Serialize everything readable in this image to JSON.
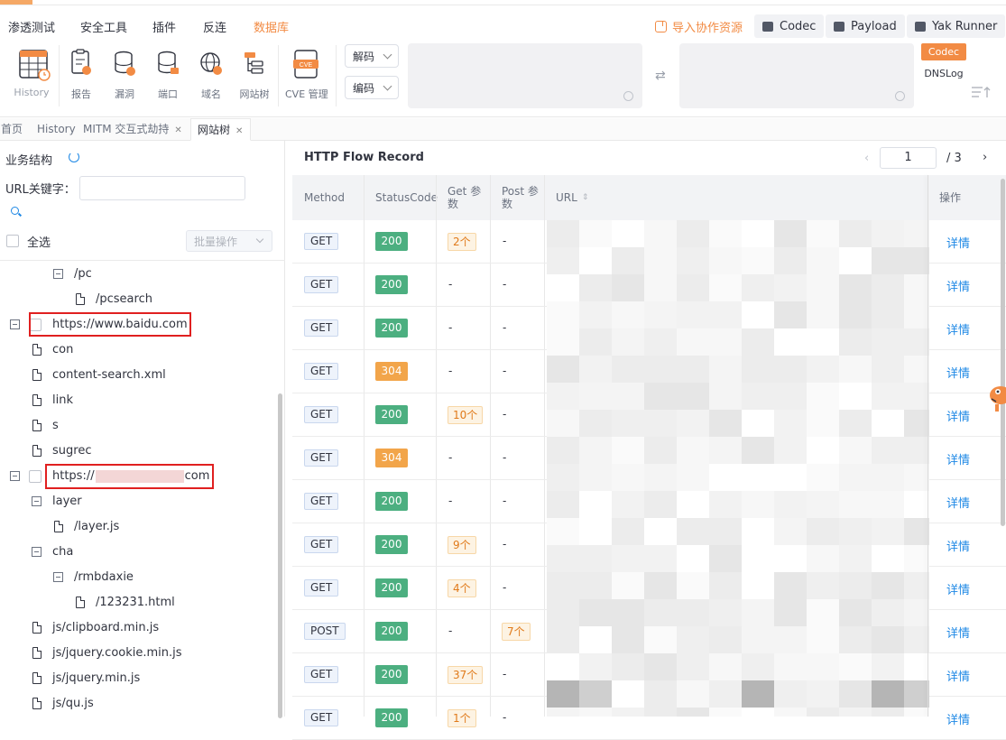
{
  "menu": {
    "items": [
      "渗透测试",
      "安全工具",
      "插件",
      "反连",
      "数据库"
    ],
    "active": "数据库",
    "import_label": "导入协作资源",
    "buttons": [
      "Codec",
      "Payload",
      "Yak Runner"
    ]
  },
  "toolbar": {
    "tools": [
      "History",
      "报告",
      "漏洞",
      "端口",
      "域名",
      "网站树",
      "CVE 管理"
    ],
    "decode_label": "解码",
    "encode_label": "编码",
    "codec_tag": "Codec",
    "dnslog_tag": "DNSLog",
    "cve_badge": "CVE"
  },
  "tabs": [
    {
      "label": "首页",
      "closable": false
    },
    {
      "label": "History",
      "closable": false
    },
    {
      "label": "MITM 交互式劫持",
      "closable": true
    },
    {
      "label": "网站树",
      "closable": true
    }
  ],
  "left_panel": {
    "title": "业务结构",
    "url_label": "URL关键字：",
    "select_all": "全选",
    "batch_label": "批量操作",
    "tree": [
      {
        "label": "/pc",
        "type": "folder",
        "depth": 2
      },
      {
        "label": "/pcsearch",
        "type": "file",
        "depth": 3
      },
      {
        "label": "https://www.baidu.com",
        "type": "root"
      },
      {
        "label": "con",
        "type": "file",
        "depth": 1
      },
      {
        "label": "content-search.xml",
        "type": "file",
        "depth": 1
      },
      {
        "label": "link",
        "type": "file",
        "depth": 1
      },
      {
        "label": "s",
        "type": "file",
        "depth": 1
      },
      {
        "label": "sugrec",
        "type": "file",
        "depth": 1
      },
      {
        "label_prefix": "https://",
        "label_suffix": "com",
        "type": "root-redacted"
      },
      {
        "label": "layer",
        "type": "folder",
        "depth": 1
      },
      {
        "label": "/layer.js",
        "type": "file",
        "depth": 2
      },
      {
        "label": "cha",
        "type": "folder",
        "depth": 1
      },
      {
        "label": "/rmbdaxie",
        "type": "folder",
        "depth": 2
      },
      {
        "label": "/123231.html",
        "type": "file",
        "depth": 3
      },
      {
        "label": "js/clipboard.min.js",
        "type": "file",
        "depth": 1
      },
      {
        "label": "js/jquery.cookie.min.js",
        "type": "file",
        "depth": 1
      },
      {
        "label": "js/jquery.min.js",
        "type": "file",
        "depth": 1
      },
      {
        "label": "js/qu.js",
        "type": "file",
        "depth": 1
      }
    ]
  },
  "records": {
    "title": "HTTP Flow Record",
    "page": "1",
    "total_pages": "/ 3",
    "headers": [
      "Method",
      "StatusCode",
      "Get 参数",
      "Post 参数",
      "URL",
      "操作"
    ],
    "detail_label": "详情",
    "rows": [
      {
        "method": "GET",
        "status": "200",
        "get": "2个",
        "post": "-"
      },
      {
        "method": "GET",
        "status": "200",
        "get": "-",
        "post": "-"
      },
      {
        "method": "GET",
        "status": "200",
        "get": "-",
        "post": "-"
      },
      {
        "method": "GET",
        "status": "304",
        "get": "-",
        "post": "-"
      },
      {
        "method": "GET",
        "status": "200",
        "get": "10个",
        "post": "-"
      },
      {
        "method": "GET",
        "status": "304",
        "get": "-",
        "post": "-"
      },
      {
        "method": "GET",
        "status": "200",
        "get": "-",
        "post": "-"
      },
      {
        "method": "GET",
        "status": "200",
        "get": "9个",
        "post": "-"
      },
      {
        "method": "GET",
        "status": "200",
        "get": "4个",
        "post": "-"
      },
      {
        "method": "POST",
        "status": "200",
        "get": "-",
        "post": "7个"
      },
      {
        "method": "GET",
        "status": "200",
        "get": "37个",
        "post": "-"
      },
      {
        "method": "GET",
        "status": "200",
        "get": "1个",
        "post": "-"
      }
    ]
  },
  "colors": {
    "accent": "#f28b44",
    "link": "#1e88e5",
    "ok": "#4caf80",
    "redirect": "#f2a54a"
  }
}
